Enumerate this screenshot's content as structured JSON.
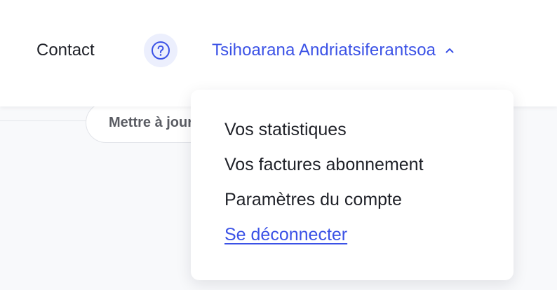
{
  "header": {
    "contact_label": "Contact",
    "help_icon": "question-circle-icon",
    "user_name": "Tsihoarana Andriatsiferantsoa",
    "chevron_icon": "chevron-up-icon"
  },
  "content": {
    "update_button_label": "Mettre à jour"
  },
  "dropdown": {
    "items": [
      {
        "label": "Vos statistiques"
      },
      {
        "label": "Vos factures abonnement"
      },
      {
        "label": "Paramètres du compte"
      },
      {
        "label": "Se déconnecter"
      }
    ]
  },
  "colors": {
    "accent": "#3b52e6",
    "text": "#1f2128",
    "help_bg": "#eceffd",
    "page_bg": "#f8f9fb"
  }
}
